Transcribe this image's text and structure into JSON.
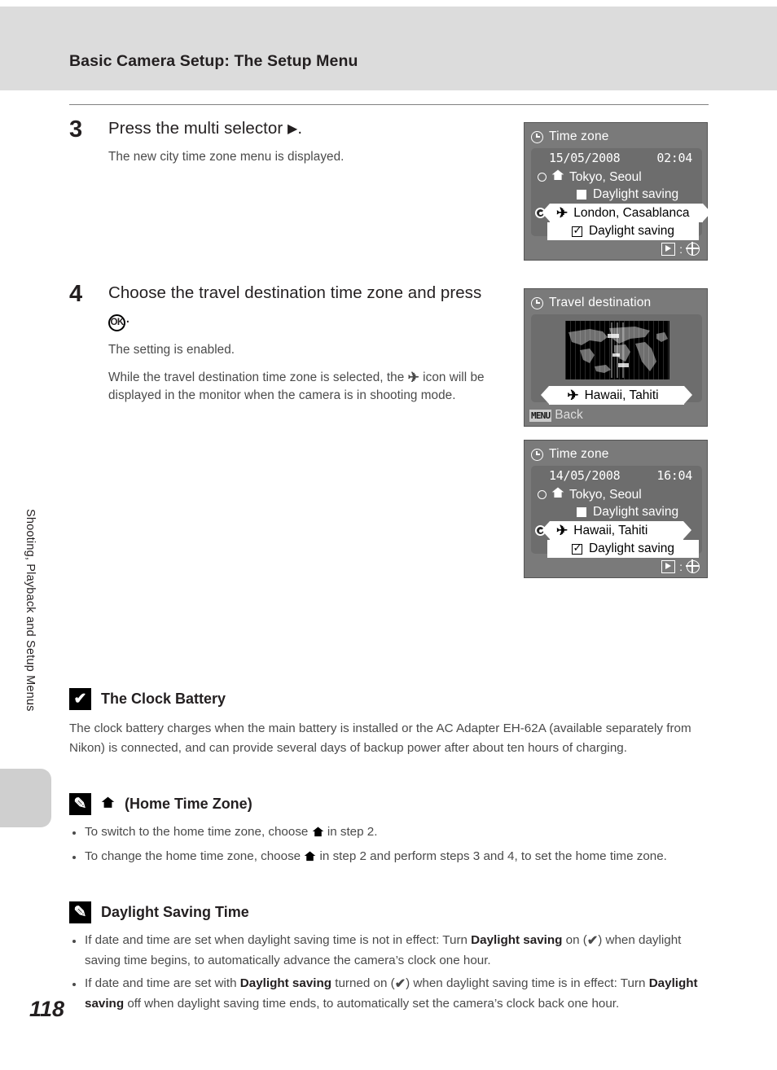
{
  "header": {
    "title": "Basic Camera Setup: The Setup Menu"
  },
  "side": {
    "chapter_label": "Shooting, Playback and Setup Menus",
    "page_number": "118"
  },
  "steps": [
    {
      "number": "3",
      "heading_pre": "Press the multi selector ",
      "heading_glyph": "right-triangle",
      "heading_post": ".",
      "notes": [
        "The new city time zone menu is displayed."
      ]
    },
    {
      "number": "4",
      "heading_pre": "Choose the travel destination time zone and press ",
      "heading_glyph": "ok-button",
      "heading_post": ".",
      "notes": [
        "The setting is enabled.",
        "While the travel destination time zone is selected, the ✈ icon will be displayed in the monitor when the camera is in shooting mode."
      ],
      "note2_part1": "While the travel destination time zone is selected, the ",
      "note2_part2": " icon will be displayed in the monitor when the camera is in shooting mode."
    }
  ],
  "screens": {
    "timezone_london": {
      "title": "Time zone",
      "date": "15/05/2008",
      "time": "02:04",
      "home_city": "Tokyo, Seoul",
      "home_dst_label": "Daylight saving",
      "home_dst_checked": false,
      "dest_city": "London, Casablanca",
      "dest_dst_label": "Daylight saving",
      "dest_dst_checked": true,
      "footer_separator": ":"
    },
    "travel_destination": {
      "title": "Travel destination",
      "city": "Hawaii, Tahiti",
      "back_chip": "MENU",
      "back_label": "Back"
    },
    "timezone_hawaii": {
      "title": "Time zone",
      "date": "14/05/2008",
      "time": "16:04",
      "home_city": "Tokyo, Seoul",
      "home_dst_label": "Daylight saving",
      "home_dst_checked": false,
      "dest_city": "Hawaii, Tahiti",
      "dest_dst_label": "Daylight saving",
      "dest_dst_checked": true,
      "footer_separator": ":"
    }
  },
  "notes": {
    "clock_battery": {
      "badge": "✔",
      "title": "The Clock Battery",
      "body": "The clock battery charges when the main battery is installed or the AC Adapter EH-62A (available separately from Nikon) is connected, and can provide several days of backup power after about ten hours of charging."
    },
    "home_time_zone": {
      "badge": "✎",
      "title_suffix": "(Home Time Zone)",
      "bullets": [
        {
          "pre": "To switch to the home time zone, choose ",
          "post": " in step 2."
        },
        {
          "pre": "To change the home time zone, choose ",
          "post": " in step 2 and perform steps 3 and 4, to set the home time zone."
        }
      ]
    },
    "daylight_saving": {
      "badge": "✎",
      "title": "Daylight Saving Time",
      "bullet1": {
        "p1": "If date and time are set when daylight saving time is not in effect: Turn ",
        "b1": "Daylight saving",
        "p2": " on (",
        "p3": ") when daylight saving time begins, to automatically advance the camera’s clock one hour."
      },
      "bullet2": {
        "p1": "If date and time are set with ",
        "b1": "Daylight saving",
        "p2": " turned on (",
        "p3": ") when daylight saving time is in effect: Turn ",
        "b2": "Daylight saving",
        "p4": " off when daylight saving time ends, to automatically set the camera’s clock back one hour."
      }
    }
  },
  "colors": {
    "header_band": "#dcdcdc",
    "side_tab": "#cfcfcf",
    "lcd_frame": "#7a7a7a",
    "lcd_panel": "#6d6d6d",
    "text": "#231f20",
    "body_text": "#4a4a4a"
  }
}
